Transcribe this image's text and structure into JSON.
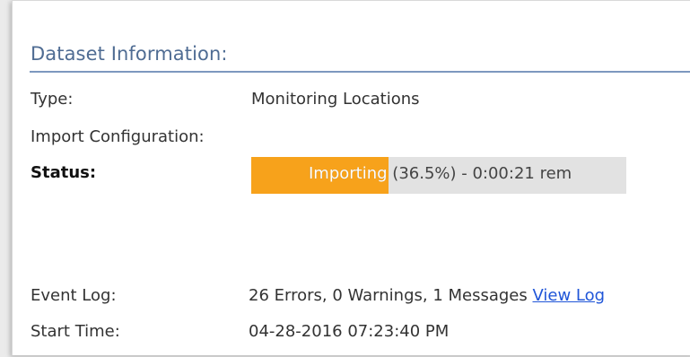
{
  "dataset": {
    "section_title": "Dataset Information:",
    "type_label": "Type:",
    "type_value": "Monitoring Locations",
    "import_config_label": "Import Configuration:",
    "import_config_value": "",
    "status_label": "Status:",
    "status_text": "Importing (36.5%) - 0:00:21 rem",
    "status_progress_percent": 36.5,
    "status_colors": {
      "fill": "#f7a21b",
      "track": "#e2e2e2"
    },
    "event_log_label": "Event Log:",
    "event_log_value": "26 Errors, 0 Warnings, 1 Messages",
    "view_log_label": "View Log",
    "start_time_label": "Start Time:",
    "start_time_value": "04-28-2016 07:23:40 PM"
  }
}
